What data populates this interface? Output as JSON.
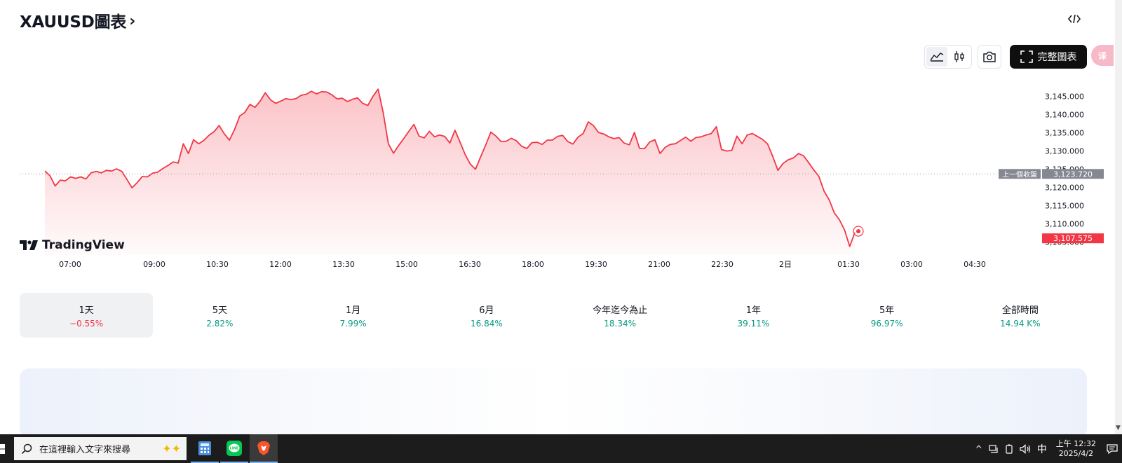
{
  "header": {
    "title": "XAUUSD圖表",
    "chevron": "›",
    "embed_icon": "</>"
  },
  "toolbar": {
    "full_chart_label": "完整圖表",
    "translate_badge": "译"
  },
  "chart_data": {
    "type": "area",
    "symbol": "XAUUSD",
    "x_ticks": [
      "07:00",
      "09:00",
      "10:30",
      "12:00",
      "13:30",
      "15:00",
      "16:30",
      "18:00",
      "19:30",
      "21:00",
      "22:30",
      "2日",
      "01:30",
      "03:00",
      "04:30"
    ],
    "y_ticks": [
      "3,145.000",
      "3,140.000",
      "3,135.000",
      "3,130.000",
      "3,125.000",
      "3,120.000",
      "3,115.000",
      "3,110.000",
      "3,105.000"
    ],
    "ylim": [
      3103,
      3148
    ],
    "previous_close": {
      "label": "上一個收盤",
      "value": "3,123.720",
      "numeric": 3123.72
    },
    "last_price": {
      "value": "3,107.575",
      "numeric": 3107.575
    },
    "line_color": "#f23645",
    "series": [
      {
        "values": [
          3124.5,
          3123.2,
          3120.4,
          3122.0,
          3121.8,
          3122.9,
          3122.5,
          3122.9,
          3122.3,
          3124.0,
          3124.4,
          3124.0,
          3124.7,
          3124.5,
          3125.1,
          3124.4,
          3122.2,
          3119.9,
          3121.3,
          3123.0,
          3122.9,
          3123.9,
          3124.2,
          3125.2,
          3126.0,
          3127.0,
          3126.7,
          3132.0,
          3129.3,
          3133.1,
          3132.0,
          3132.9,
          3134.3,
          3135.3,
          3137.0,
          3134.7,
          3133.0,
          3135.9,
          3139.6,
          3140.6,
          3142.8,
          3142.0,
          3143.7,
          3146.0,
          3144.1,
          3143.1,
          3143.7,
          3144.4,
          3144.1,
          3144.4,
          3145.3,
          3145.6,
          3146.4,
          3145.7,
          3146.3,
          3146.2,
          3145.4,
          3144.3,
          3144.5,
          3143.6,
          3144.2,
          3144.6,
          3143.1,
          3142.5,
          3145.0,
          3147.0,
          3140.5,
          3132.0,
          3129.4,
          3131.5,
          3133.4,
          3135.4,
          3137.3,
          3134.1,
          3133.6,
          3135.4,
          3133.9,
          3134.4,
          3134.0,
          3132.2,
          3135.7,
          3132.4,
          3129.0,
          3126.4,
          3125.0,
          3128.4,
          3131.7,
          3135.2,
          3134.1,
          3132.6,
          3132.7,
          3133.5,
          3132.8,
          3131.3,
          3130.7,
          3132.3,
          3132.4,
          3131.8,
          3133.0,
          3133.0,
          3134.0,
          3134.3,
          3132.6,
          3131.9,
          3133.8,
          3134.8,
          3138.0,
          3137.0,
          3135.1,
          3134.7,
          3133.9,
          3133.4,
          3133.7,
          3132.2,
          3131.7,
          3135.1,
          3130.7,
          3130.7,
          3132.5,
          3133.1,
          3129.3,
          3131.0,
          3131.8,
          3132.0,
          3132.9,
          3133.8,
          3132.7,
          3133.7,
          3133.9,
          3134.4,
          3134.8,
          3136.7,
          3130.4,
          3130.0,
          3130.2,
          3134.1,
          3132.0,
          3134.4,
          3134.8,
          3134.0,
          3133.2,
          3131.9,
          3128.5,
          3124.7,
          3126.6,
          3127.6,
          3128.1,
          3129.3,
          3128.7,
          3126.8,
          3124.8,
          3123.0,
          3119.0,
          3116.6,
          3113.0,
          3111.1,
          3108.3,
          3103.8,
          3107.6
        ]
      }
    ],
    "series_x_start_hours": 6.4,
    "series_x_end_hours": 25.65,
    "x_range_hours": [
      5.8,
      29.5
    ]
  },
  "ranges": [
    {
      "label": "1天",
      "value": "−0.55%",
      "trend": "neg",
      "selected": true
    },
    {
      "label": "5天",
      "value": "2.82%",
      "trend": "pos"
    },
    {
      "label": "1月",
      "value": "7.99%",
      "trend": "pos"
    },
    {
      "label": "6月",
      "value": "16.84%",
      "trend": "pos"
    },
    {
      "label": "今年迄今為止",
      "value": "18.34%",
      "trend": "pos"
    },
    {
      "label": "1年",
      "value": "39.11%",
      "trend": "pos"
    },
    {
      "label": "5年",
      "value": "96.97%",
      "trend": "pos"
    },
    {
      "label": "全部時間",
      "value": "14.94 K%",
      "trend": "pos"
    }
  ],
  "branding": {
    "logo_text": "TradingView"
  },
  "taskbar": {
    "search_placeholder": "在這裡輸入文字來搜尋",
    "ime_label": "中",
    "time": "上午 12:32",
    "date": "2025/4/2"
  }
}
